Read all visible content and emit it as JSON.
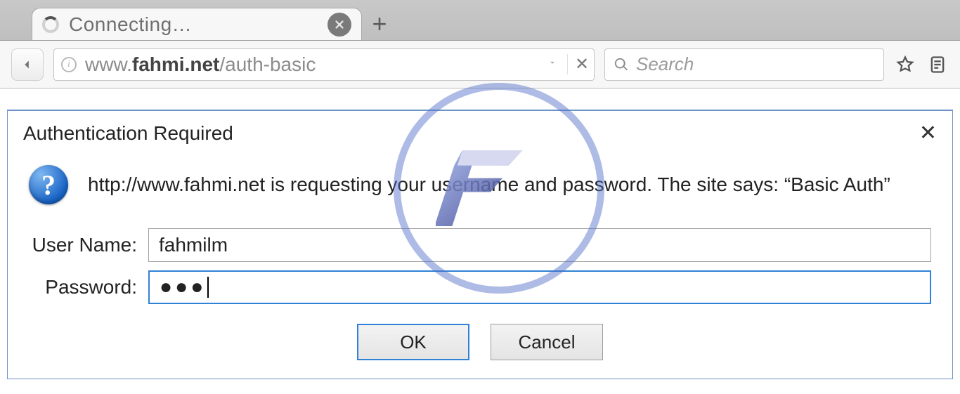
{
  "tab": {
    "title": "Connecting…"
  },
  "url": {
    "prefix": "www.",
    "host_bold": "fahmi.net",
    "path": "/auth-basic"
  },
  "search": {
    "placeholder": "Search"
  },
  "dialog": {
    "title": "Authentication Required",
    "message": "http://www.fahmi.net is requesting your username and password. The site says: “Basic Auth”",
    "username_label": "User Name:",
    "password_label": "Password:",
    "username_value": "fahmilm",
    "password_masked": "●●●",
    "ok_label": "OK",
    "cancel_label": "Cancel"
  }
}
